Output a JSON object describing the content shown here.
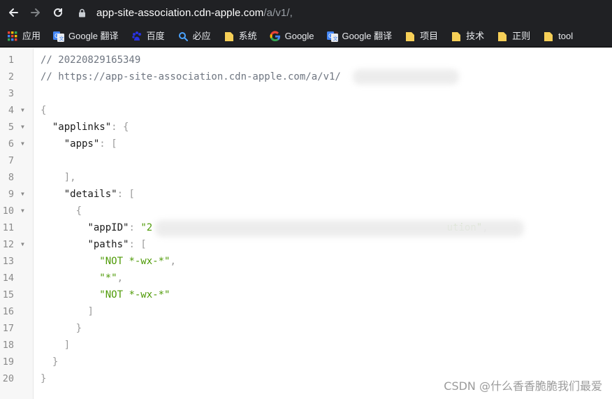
{
  "browser": {
    "url_host": "app-site-association.cdn-apple.com",
    "url_path": "/a/v1/,",
    "bookmarks": [
      {
        "icon": "apps-grid-icon",
        "label": "应用"
      },
      {
        "icon": "google-translate-icon",
        "label": "Google 翻译"
      },
      {
        "icon": "baidu-icon",
        "label": "百度"
      },
      {
        "icon": "search-icon",
        "label": "必应"
      },
      {
        "icon": "folder-icon",
        "label": "系统"
      },
      {
        "icon": "google-icon",
        "label": "Google"
      },
      {
        "icon": "google-translate-icon",
        "label": "Google 翻译"
      },
      {
        "icon": "folder-icon",
        "label": "项目"
      },
      {
        "icon": "folder-icon",
        "label": "技术"
      },
      {
        "icon": "folder-icon",
        "label": "正则"
      },
      {
        "icon": "folder-icon",
        "label": "tool"
      }
    ]
  },
  "code": {
    "lines": [
      {
        "n": "1",
        "fold": false,
        "t": [
          {
            "c": "c-comment",
            "s": "// 20220829165349"
          }
        ]
      },
      {
        "n": "2",
        "fold": false,
        "t": [
          {
            "c": "c-comment",
            "s": "// https://app-site-association.cdn-apple.com/a/v1/"
          }
        ]
      },
      {
        "n": "3",
        "fold": false,
        "t": []
      },
      {
        "n": "4",
        "fold": true,
        "t": [
          {
            "c": "c-punc",
            "s": "{"
          }
        ]
      },
      {
        "n": "5",
        "fold": true,
        "t": [
          {
            "c": "",
            "s": "  "
          },
          {
            "c": "c-key",
            "s": "\"applinks\""
          },
          {
            "c": "c-punc",
            "s": ": {"
          }
        ]
      },
      {
        "n": "6",
        "fold": true,
        "t": [
          {
            "c": "",
            "s": "    "
          },
          {
            "c": "c-key",
            "s": "\"apps\""
          },
          {
            "c": "c-punc",
            "s": ": ["
          }
        ]
      },
      {
        "n": "7",
        "fold": false,
        "t": []
      },
      {
        "n": "8",
        "fold": false,
        "t": [
          {
            "c": "",
            "s": "    "
          },
          {
            "c": "c-punc",
            "s": "],"
          }
        ]
      },
      {
        "n": "9",
        "fold": true,
        "t": [
          {
            "c": "",
            "s": "    "
          },
          {
            "c": "c-key",
            "s": "\"details\""
          },
          {
            "c": "c-punc",
            "s": ": ["
          }
        ]
      },
      {
        "n": "10",
        "fold": true,
        "t": [
          {
            "c": "",
            "s": "      "
          },
          {
            "c": "c-punc",
            "s": "{"
          }
        ]
      },
      {
        "n": "11",
        "fold": false,
        "t": [
          {
            "c": "",
            "s": "        "
          },
          {
            "c": "c-key",
            "s": "\"appID\""
          },
          {
            "c": "c-punc",
            "s": ": "
          },
          {
            "c": "c-str",
            "s": "\"2"
          },
          {
            "c": "",
            "s": "                                                  "
          },
          {
            "c": "c-str",
            "s": "ution\""
          },
          {
            "c": "c-punc",
            "s": ","
          }
        ]
      },
      {
        "n": "12",
        "fold": true,
        "t": [
          {
            "c": "",
            "s": "        "
          },
          {
            "c": "c-key",
            "s": "\"paths\""
          },
          {
            "c": "c-punc",
            "s": ": ["
          }
        ]
      },
      {
        "n": "13",
        "fold": false,
        "t": [
          {
            "c": "",
            "s": "          "
          },
          {
            "c": "c-str",
            "s": "\"NOT *-wx-*\""
          },
          {
            "c": "c-punc",
            "s": ","
          }
        ]
      },
      {
        "n": "14",
        "fold": false,
        "t": [
          {
            "c": "",
            "s": "          "
          },
          {
            "c": "c-str",
            "s": "\"*\""
          },
          {
            "c": "c-punc",
            "s": ","
          }
        ]
      },
      {
        "n": "15",
        "fold": false,
        "t": [
          {
            "c": "",
            "s": "          "
          },
          {
            "c": "c-str",
            "s": "\"NOT *-wx-*\""
          }
        ]
      },
      {
        "n": "16",
        "fold": false,
        "t": [
          {
            "c": "",
            "s": "        "
          },
          {
            "c": "c-punc",
            "s": "]"
          }
        ]
      },
      {
        "n": "17",
        "fold": false,
        "t": [
          {
            "c": "",
            "s": "      "
          },
          {
            "c": "c-punc",
            "s": "}"
          }
        ]
      },
      {
        "n": "18",
        "fold": false,
        "t": [
          {
            "c": "",
            "s": "    "
          },
          {
            "c": "c-punc",
            "s": "]"
          }
        ]
      },
      {
        "n": "19",
        "fold": false,
        "t": [
          {
            "c": "",
            "s": "  "
          },
          {
            "c": "c-punc",
            "s": "}"
          }
        ]
      },
      {
        "n": "20",
        "fold": false,
        "t": [
          {
            "c": "c-punc",
            "s": "}"
          }
        ]
      }
    ]
  },
  "watermark": "CSDN @什么香香脆脆我们最爱",
  "colors": {
    "chrome_bg": "#202124",
    "string_green": "#4e9a06",
    "comment_gray": "#6f7681"
  }
}
